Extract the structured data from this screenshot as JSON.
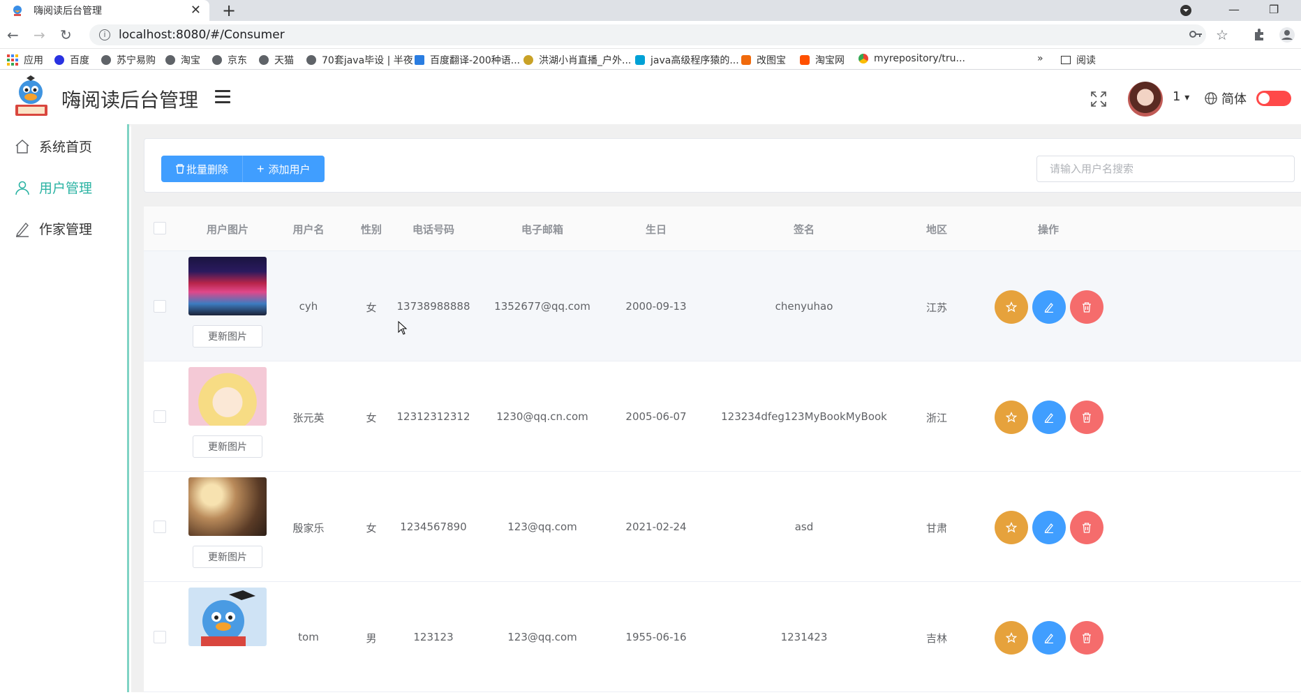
{
  "browser": {
    "tab_title": "嗨阅读后台管理",
    "url": "localhost:8080/#/Consumer",
    "bookmarks": [
      "应用",
      "百度",
      "苏宁易购",
      "淘宝",
      "京东",
      "天猫",
      "70套java毕设 | 半夜",
      "百度翻译-200种语...",
      "洪湖小肖直播_户外...",
      "java高级程序猿的...",
      "改图宝",
      "淘宝网",
      "myrepository/tru...",
      "»",
      "阅读"
    ]
  },
  "header": {
    "title": "嗨阅读后台管理",
    "user": "1",
    "user_caret": "▾",
    "language": "简体"
  },
  "sidebar": {
    "items": [
      {
        "label": "系统首页",
        "icon": "home-icon",
        "active": false
      },
      {
        "label": "用户管理",
        "icon": "user-icon",
        "active": true
      },
      {
        "label": "作家管理",
        "icon": "pen-icon",
        "active": false
      }
    ]
  },
  "toolbar": {
    "batch_delete_label": "批量删除",
    "add_user_label": "添加用户",
    "search_placeholder": "请输入用户名搜索"
  },
  "table": {
    "columns": [
      "用户图片",
      "用户名",
      "性别",
      "电话号码",
      "电子邮箱",
      "生日",
      "签名",
      "地区",
      "操作"
    ],
    "update_pic_label": "更新图片",
    "rows": [
      {
        "username": "cyh",
        "gender": "女",
        "phone": "13738988888",
        "email": "1352677@qq.com",
        "birthday": "2000-09-13",
        "signature": "chenyuhao",
        "region": "江苏"
      },
      {
        "username": "张元英",
        "gender": "女",
        "phone": "12312312312",
        "email": "1230@qq.cn.com",
        "birthday": "2005-06-07",
        "signature": "123234dfeg123MyBookMyBook",
        "region": "浙江"
      },
      {
        "username": "殷家乐",
        "gender": "女",
        "phone": "1234567890",
        "email": "123@qq.com",
        "birthday": "2021-02-24",
        "signature": "asd",
        "region": "甘肃"
      },
      {
        "username": "tom",
        "gender": "男",
        "phone": "123123",
        "email": "123@qq.com",
        "birthday": "1955-06-16",
        "signature": "1231423",
        "region": "吉林"
      }
    ]
  },
  "colors": {
    "primary": "#409eff",
    "star": "#e6a23c",
    "danger": "#f56c6c",
    "sidebar_active": "#2bb3a3",
    "toggle": "#ff4949"
  }
}
